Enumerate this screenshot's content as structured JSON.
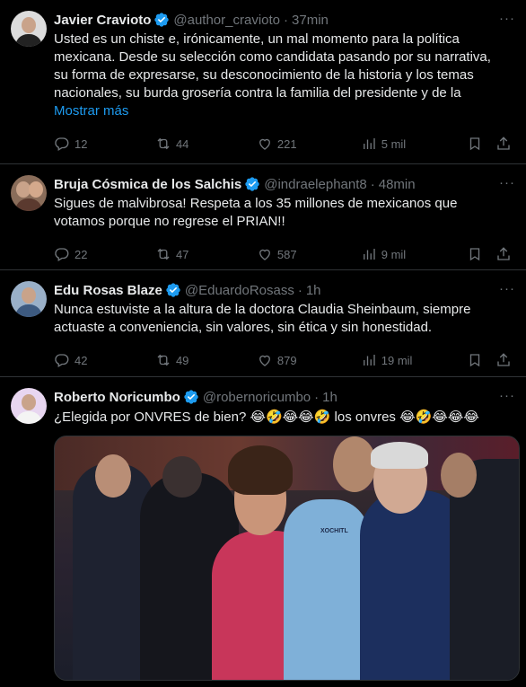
{
  "tweets": [
    {
      "name": "Javier Cravioto",
      "handle": "@author_cravioto",
      "time": "37min",
      "lines": [
        "Usted es un chiste e, irónicamente, un mal momento para la política",
        "mexicana. Desde su selección como candidata pasando por su narrativa,",
        "su forma de expresarse, su desconocimiento de la historia y los temas",
        "nacionales, su burda grosería contra la familia del presidente y de la"
      ],
      "show_more": "Mostrar más",
      "replies": "12",
      "retweets": "44",
      "likes": "221",
      "views": "5 mil"
    },
    {
      "name": "Bruja Cósmica de los Salchis",
      "handle": "@indraelephant8",
      "time": "48min",
      "lines": [
        "Sigues de malvibrosa! Respeta a los 35 millones de mexicanos que",
        "votamos porque no regrese el PRIAN!!"
      ],
      "replies": "22",
      "retweets": "47",
      "likes": "587",
      "views": "9 mil"
    },
    {
      "name": "Edu Rosas Blaze",
      "handle": "@EduardoRosass",
      "time": "1h",
      "lines": [
        "Nunca estuviste a la altura de la doctora Claudia Sheinbaum, siempre",
        "actuaste a conveniencia, sin valores, sin ética y sin honestidad."
      ],
      "replies": "42",
      "retweets": "49",
      "likes": "879",
      "views": "19 mil"
    },
    {
      "name": "Roberto Noricumbo",
      "handle": "@robernoricumbo",
      "time": "1h",
      "text_a": "¿Elegida por ONVRES de bien? ",
      "emoji_a": "😂🤣😂😂🤣",
      "text_b": " los onvres ",
      "emoji_b": "😂🤣😂😂😂",
      "photo_shirt_text": "XOCHITL"
    }
  ],
  "more_glyph": "···",
  "dot": "·",
  "colors": {
    "background": "#000000",
    "text": "#e7e9ea",
    "muted": "#71767b",
    "link": "#1d9bf0",
    "verified": "#1d9bf0",
    "divider": "#2f3336"
  },
  "icons": [
    "reply-icon",
    "retweet-icon",
    "like-icon",
    "views-icon",
    "bookmark-icon",
    "share-icon",
    "verified-icon",
    "more-icon"
  ]
}
